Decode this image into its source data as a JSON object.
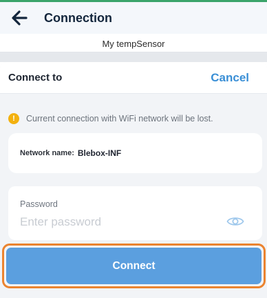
{
  "header": {
    "title": "Connection"
  },
  "device_bar": {
    "name": "My tempSensor"
  },
  "dialog": {
    "title": "Connect to",
    "cancel_label": "Cancel",
    "warning": "Current connection with WiFi network will be lost.",
    "network": {
      "label": "Network name:",
      "value": "Blebox-INF"
    },
    "password": {
      "label": "Password",
      "placeholder": "Enter password",
      "value": ""
    },
    "connect_label": "Connect"
  },
  "colors": {
    "accent_green": "#3aa46a",
    "link_blue": "#3a8fd6",
    "button_blue": "#5b9fdf",
    "warning_yellow": "#f3b10f",
    "highlight_orange": "#eb8430"
  },
  "icons": {
    "back": "arrow-left-icon",
    "warning": "warning-icon",
    "eye": "eye-icon"
  }
}
